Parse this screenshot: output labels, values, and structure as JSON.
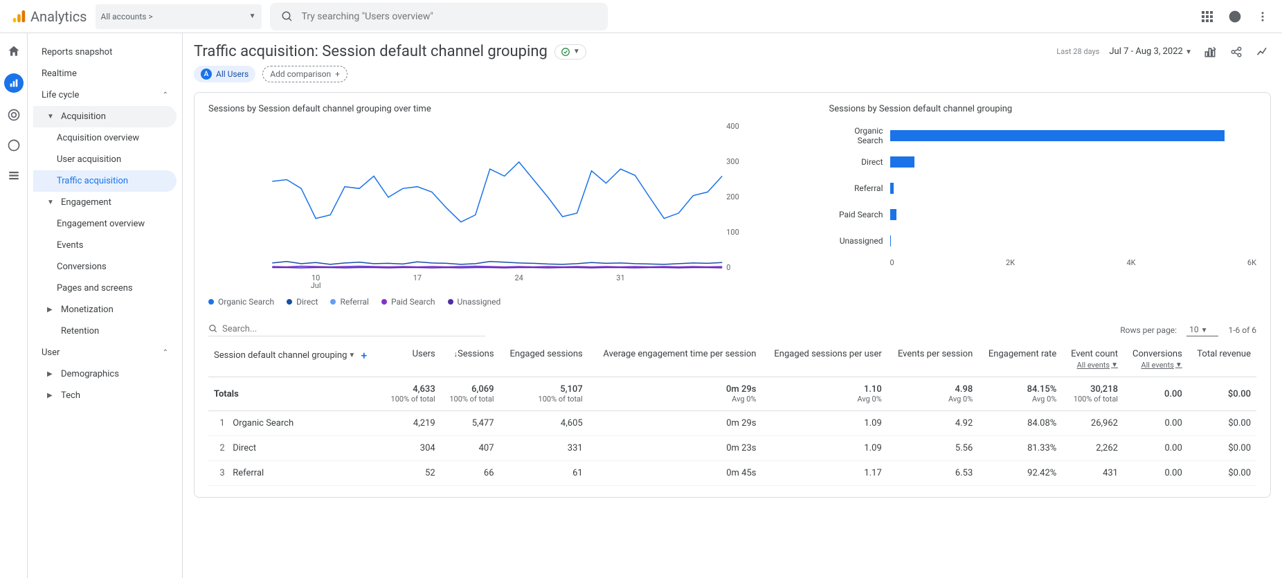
{
  "brand": "Analytics",
  "account_picker_prefix": "All accounts >",
  "search_placeholder": "Try searching \"Users overview\"",
  "sidebar": {
    "items": [
      {
        "label": "Reports snapshot",
        "level": 1
      },
      {
        "label": "Realtime",
        "level": 1
      },
      {
        "label": "Life cycle",
        "level": 1,
        "section": true,
        "expanded": true
      },
      {
        "label": "Acquisition",
        "level": 2,
        "expanded": true,
        "activeGroup": true
      },
      {
        "label": "Acquisition overview",
        "level": 3
      },
      {
        "label": "User acquisition",
        "level": 3
      },
      {
        "label": "Traffic acquisition",
        "level": 3,
        "active": true
      },
      {
        "label": "Engagement",
        "level": 2,
        "expanded": true
      },
      {
        "label": "Engagement overview",
        "level": 3
      },
      {
        "label": "Events",
        "level": 3
      },
      {
        "label": "Conversions",
        "level": 3
      },
      {
        "label": "Pages and screens",
        "level": 3
      },
      {
        "label": "Monetization",
        "level": 2,
        "expanded": false
      },
      {
        "label": "Retention",
        "level": 2
      },
      {
        "label": "User",
        "level": 1,
        "section": true,
        "expanded": true
      },
      {
        "label": "Demographics",
        "level": 2,
        "expanded": false
      },
      {
        "label": "Tech",
        "level": 2,
        "expanded": false
      }
    ]
  },
  "page": {
    "title": "Traffic acquisition: Session default channel grouping",
    "all_users": "All Users",
    "add_comparison": "Add comparison",
    "date_prefix": "Last 28 days",
    "date_range": "Jul 7 - Aug 3, 2022"
  },
  "chart_data": [
    {
      "type": "line",
      "title": "Sessions by Session default channel grouping over time",
      "x_ticks": [
        "10",
        "17",
        "24",
        "31"
      ],
      "x_sublabel": "Jul",
      "y_ticks": [
        0,
        100,
        200,
        300,
        400
      ],
      "ylim": [
        0,
        400
      ],
      "series": [
        {
          "name": "Organic Search",
          "color": "#1a73e8",
          "values": [
            245,
            250,
            225,
            140,
            150,
            230,
            225,
            260,
            200,
            225,
            230,
            215,
            170,
            130,
            150,
            280,
            260,
            300,
            250,
            200,
            145,
            155,
            275,
            240,
            280,
            262,
            200,
            140,
            155,
            205,
            215,
            260
          ]
        },
        {
          "name": "Direct",
          "color": "#174ea6",
          "values": [
            14,
            18,
            12,
            15,
            10,
            14,
            16,
            12,
            13,
            11,
            17,
            14,
            13,
            10,
            12,
            18,
            16,
            14,
            13,
            11,
            10,
            12,
            15,
            13,
            14,
            12,
            11,
            10,
            12,
            14,
            13,
            15
          ]
        },
        {
          "name": "Referral",
          "color": "#669df6",
          "values": [
            3,
            2,
            4,
            3,
            2,
            2,
            3,
            2,
            3,
            2,
            2,
            3,
            2,
            2,
            3,
            3,
            2,
            3,
            2,
            2,
            2,
            3,
            2,
            3,
            2,
            2,
            2,
            3,
            2,
            2,
            3,
            2
          ]
        },
        {
          "name": "Paid Search",
          "color": "#8430ce",
          "values": [
            4,
            3,
            5,
            4,
            3,
            4,
            5,
            4,
            3,
            4,
            3,
            4,
            3,
            4,
            5,
            4,
            3,
            4,
            3,
            4,
            3,
            4,
            3,
            4,
            3,
            4,
            3,
            4,
            3,
            4,
            3,
            4
          ]
        },
        {
          "name": "Unassigned",
          "color": "#512da8",
          "values": [
            1,
            1,
            0,
            1,
            1,
            0,
            1,
            1,
            0,
            1,
            1,
            0,
            1,
            0,
            1,
            1,
            0,
            1,
            1,
            0,
            1,
            1,
            0,
            1,
            1,
            0,
            1,
            1,
            0,
            1,
            1,
            0
          ]
        }
      ]
    },
    {
      "type": "bar",
      "title": "Sessions by Session default channel grouping",
      "orientation": "horizontal",
      "x_ticks": [
        "0",
        "2K",
        "4K",
        "6K"
      ],
      "xlim": 6000,
      "categories": [
        "Organic Search",
        "Direct",
        "Referral",
        "Paid Search",
        "Unassigned"
      ],
      "values": [
        5477,
        407,
        66,
        110,
        9
      ],
      "color": "#1a73e8"
    }
  ],
  "legend": [
    "Organic Search",
    "Direct",
    "Referral",
    "Paid Search",
    "Unassigned"
  ],
  "legend_colors": [
    "#1a73e8",
    "#174ea6",
    "#669df6",
    "#8430ce",
    "#512da8"
  ],
  "table": {
    "search_placeholder": "Search...",
    "rows_per_page_label": "Rows per page:",
    "rows_per_page_value": "10",
    "page_info": "1-6 of 6",
    "dimension_header": "Session default channel grouping",
    "columns": [
      {
        "label": "Users"
      },
      {
        "label": "Sessions",
        "sorted": true
      },
      {
        "label": "Engaged sessions"
      },
      {
        "label": "Average engagement time per session"
      },
      {
        "label": "Engaged sessions per user"
      },
      {
        "label": "Events per session"
      },
      {
        "label": "Engagement rate"
      },
      {
        "label": "Event count",
        "sub": "All events"
      },
      {
        "label": "Conversions",
        "sub": "All events"
      },
      {
        "label": "Total revenue"
      }
    ],
    "totals_label": "Totals",
    "totals": [
      {
        "v": "4,633",
        "s": "100% of total"
      },
      {
        "v": "6,069",
        "s": "100% of total"
      },
      {
        "v": "5,107",
        "s": "100% of total"
      },
      {
        "v": "0m 29s",
        "s": "Avg 0%"
      },
      {
        "v": "1.10",
        "s": "Avg 0%"
      },
      {
        "v": "4.98",
        "s": "Avg 0%"
      },
      {
        "v": "84.15%",
        "s": "Avg 0%"
      },
      {
        "v": "30,218",
        "s": "100% of total"
      },
      {
        "v": "0.00",
        "s": ""
      },
      {
        "v": "$0.00",
        "s": ""
      }
    ],
    "rows": [
      {
        "idx": "1",
        "dim": "Organic Search",
        "cells": [
          "4,219",
          "5,477",
          "4,605",
          "0m 29s",
          "1.09",
          "4.92",
          "84.08%",
          "26,962",
          "0.00",
          "$0.00"
        ]
      },
      {
        "idx": "2",
        "dim": "Direct",
        "cells": [
          "304",
          "407",
          "331",
          "0m 23s",
          "1.09",
          "5.56",
          "81.33%",
          "2,262",
          "0.00",
          "$0.00"
        ]
      },
      {
        "idx": "3",
        "dim": "Referral",
        "cells": [
          "52",
          "66",
          "61",
          "0m 45s",
          "1.17",
          "6.53",
          "92.42%",
          "431",
          "0.00",
          "$0.00"
        ]
      }
    ]
  }
}
